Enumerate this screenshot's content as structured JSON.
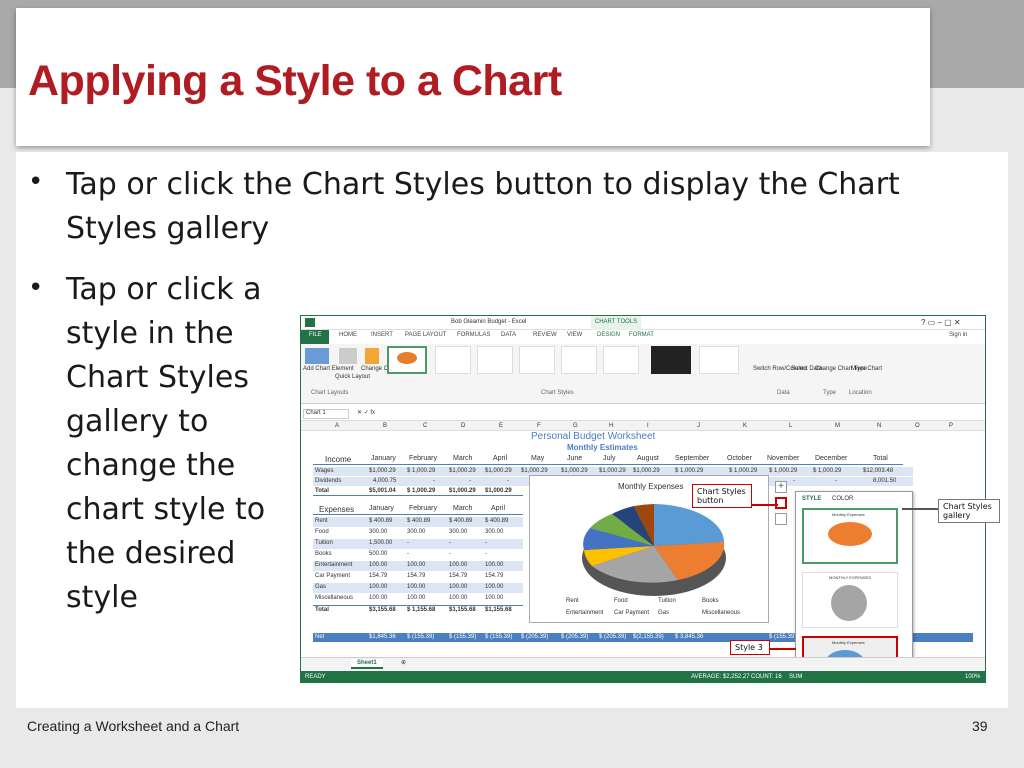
{
  "slide": {
    "title": "Applying a Style to a Chart",
    "bullets": [
      "Tap or click the Chart Styles button to display the Chart Styles gallery",
      "Tap or click a style in the Chart Styles gallery to change the chart style to the desired style"
    ],
    "footer_left": "Creating a Worksheet and a Chart",
    "page_number": "39"
  },
  "excel": {
    "window_title": "Bob Gleamin Budget - Excel",
    "chart_tools": "CHART TOOLS",
    "sign_in": "Sign in",
    "tabs": [
      "FILE",
      "HOME",
      "INSERT",
      "PAGE LAYOUT",
      "FORMULAS",
      "DATA",
      "REVIEW",
      "VIEW",
      "DESIGN",
      "FORMAT"
    ],
    "ribbon_buttons": [
      "Add Chart Element",
      "Quick Layout",
      "Change Colors",
      "Switch Row/Column",
      "Select Data",
      "Change Chart Type",
      "Move Chart"
    ],
    "ribbon_groups": [
      "Chart Layouts",
      "Chart Styles",
      "Data",
      "Type",
      "Location"
    ],
    "name_box": "Chart 1",
    "columns": [
      "A",
      "B",
      "C",
      "D",
      "E",
      "F",
      "G",
      "H",
      "I",
      "J",
      "K",
      "L",
      "M",
      "N",
      "O",
      "P"
    ],
    "sheet_title": "Personal Budget Worksheet",
    "sheet_subtitle": "Monthly Estimates",
    "header_row": [
      "Income",
      "January",
      "February",
      "March",
      "April",
      "May",
      "June",
      "July",
      "August",
      "September",
      "October",
      "November",
      "December",
      "Total"
    ],
    "income_rows": [
      [
        "Wages",
        "$1,000.29",
        "$ 1,000.29",
        "$1,000.29",
        "$1,000.29",
        "$1,000.29",
        "$1,000.29",
        "$1,000.29",
        "$1,000.29",
        "$ 1,000.29",
        "$ 1,000.29",
        "$ 1,000.29",
        "$ 1,000.29",
        "$12,003.48"
      ],
      [
        "Dividends",
        "4,000.75",
        "-",
        "-",
        "-",
        "",
        "",
        "",
        "",
        "",
        "",
        "-",
        "-",
        "8,001.50"
      ],
      [
        "Total",
        "$5,001.04",
        "$ 1,000.29",
        "$1,000.29",
        "$1,000.29",
        "",
        "",
        "",
        "",
        "",
        "",
        "",
        "",
        ""
      ]
    ],
    "expense_header": [
      "Expenses",
      "January",
      "February",
      "March",
      "April"
    ],
    "expense_rows": [
      [
        "Rent",
        "$ 400.89",
        "$ 400.89",
        "$ 400.89",
        "$ 400.89"
      ],
      [
        "Food",
        "300.00",
        "300.00",
        "300.00",
        "300.00"
      ],
      [
        "Tuition",
        "1,500.00",
        "-",
        "-",
        "-"
      ],
      [
        "Books",
        "500.00",
        "-",
        "-",
        "-"
      ],
      [
        "Entertainment",
        "100.00",
        "100.00",
        "100.00",
        "100.00"
      ],
      [
        "Car Payment",
        "154.79",
        "154.79",
        "154.79",
        "154.79"
      ],
      [
        "Gas",
        "100.00",
        "100.00",
        "100.00",
        "100.00"
      ],
      [
        "Miscellaneous",
        "100.00",
        "100.00",
        "100.00",
        "100.00"
      ],
      [
        "Total",
        "$3,155.68",
        "$ 1,155.68",
        "$1,155.68",
        "$1,155.68"
      ]
    ],
    "net_row": [
      "Net",
      "$1,845.36",
      "$ (155.39)",
      "$ (155.39)",
      "$ (155.39)",
      "$ (205.39)",
      "$ (205.39)",
      "$ (205.39)",
      "$(2,155.39)",
      "$ 3,845.36",
      "$ (155.39)"
    ],
    "chart_title": "Monthly Expenses",
    "chart_legend": [
      "Rent",
      "Food",
      "Tuition",
      "Books",
      "Entertainment",
      "Car Payment",
      "Gas",
      "Miscellaneous"
    ],
    "gallery_tabs": [
      "STYLE",
      "COLOR"
    ],
    "gallery_item_titles": [
      "Monthly Expenses",
      "MONTHLY EXPENSES",
      "Monthly Expenses"
    ],
    "sheet_tab": "Sheet1",
    "status_ready": "READY",
    "status_average": "AVERAGE: $2,252.27",
    "status_count": "COUNT: 16",
    "status_sum": "SUM",
    "zoom": "100%"
  },
  "callouts": {
    "chart_styles_button": "Chart Styles button",
    "chart_styles_gallery": "Chart Styles gallery",
    "style3": "Style 3"
  },
  "colors": {
    "title_red": "#b01c22",
    "excel_green": "#217346",
    "callout_red": "#cc0000"
  }
}
